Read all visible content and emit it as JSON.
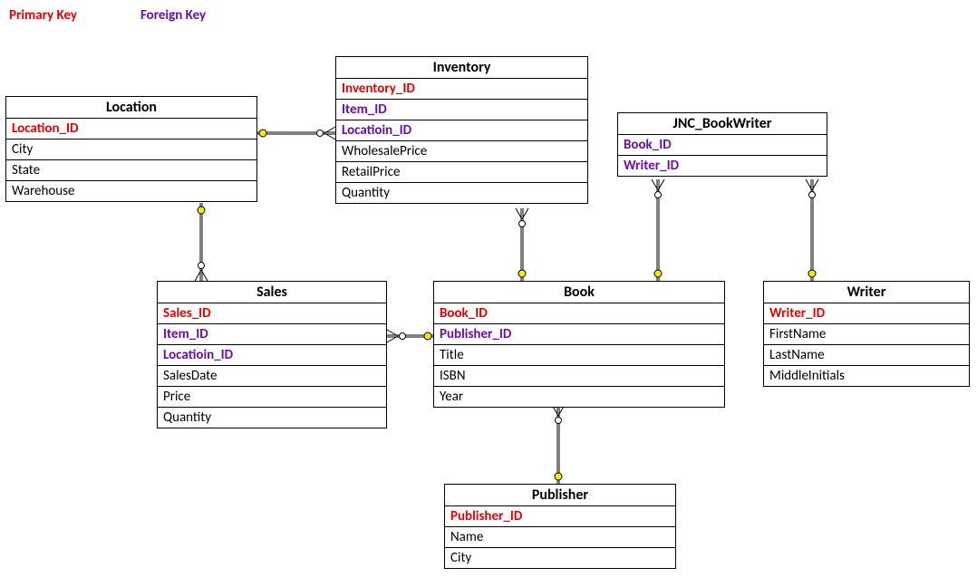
{
  "legend": {
    "pk": "Primary Key",
    "fk": "Foreign Key"
  },
  "entities": {
    "location": {
      "title": "Location",
      "fields": [
        {
          "name": "Location_ID",
          "type": "pk"
        },
        {
          "name": "City",
          "type": ""
        },
        {
          "name": "State",
          "type": ""
        },
        {
          "name": "Warehouse",
          "type": ""
        }
      ]
    },
    "inventory": {
      "title": "Inventory",
      "fields": [
        {
          "name": "Inventory_ID",
          "type": "pk"
        },
        {
          "name": "Item_ID",
          "type": "fk"
        },
        {
          "name": "Locatioin_ID",
          "type": "fk"
        },
        {
          "name": "WholesalePrice",
          "type": ""
        },
        {
          "name": "RetailPrice",
          "type": ""
        },
        {
          "name": "Quantity",
          "type": ""
        }
      ]
    },
    "jnc": {
      "title": "JNC_BookWriter",
      "fields": [
        {
          "name": "Book_ID",
          "type": "fk"
        },
        {
          "name": "Writer_ID",
          "type": "fk"
        }
      ]
    },
    "sales": {
      "title": "Sales",
      "fields": [
        {
          "name": "Sales_ID",
          "type": "pk"
        },
        {
          "name": "Item_ID",
          "type": "fk"
        },
        {
          "name": "Locatioin_ID",
          "type": "fk"
        },
        {
          "name": "SalesDate",
          "type": ""
        },
        {
          "name": "Price",
          "type": ""
        },
        {
          "name": "Quantity",
          "type": ""
        }
      ]
    },
    "book": {
      "title": "Book",
      "fields": [
        {
          "name": "Book_ID",
          "type": "pk"
        },
        {
          "name": "Publisher_ID",
          "type": "fk"
        },
        {
          "name": "Title",
          "type": ""
        },
        {
          "name": "ISBN",
          "type": ""
        },
        {
          "name": "Year",
          "type": ""
        }
      ]
    },
    "writer": {
      "title": "Writer",
      "fields": [
        {
          "name": "Writer_ID",
          "type": "pk"
        },
        {
          "name": "FirstName",
          "type": ""
        },
        {
          "name": "LastName",
          "type": ""
        },
        {
          "name": "MiddleInitials",
          "type": ""
        }
      ]
    },
    "publisher": {
      "title": "Publisher",
      "fields": [
        {
          "name": "Publisher_ID",
          "type": "pk"
        },
        {
          "name": "Name",
          "type": ""
        },
        {
          "name": "City",
          "type": ""
        }
      ]
    }
  },
  "relationships": [
    {
      "from": "location",
      "to": "inventory",
      "label": "Location-Inventory"
    },
    {
      "from": "location",
      "to": "sales",
      "label": "Location-Sales"
    },
    {
      "from": "inventory",
      "to": "book",
      "label": "Inventory-Book"
    },
    {
      "from": "sales",
      "to": "book",
      "label": "Sales-Book"
    },
    {
      "from": "book",
      "to": "publisher",
      "label": "Book-Publisher"
    },
    {
      "from": "book",
      "to": "jnc",
      "label": "Book-JNC"
    },
    {
      "from": "writer",
      "to": "jnc",
      "label": "Writer-JNC"
    }
  ]
}
